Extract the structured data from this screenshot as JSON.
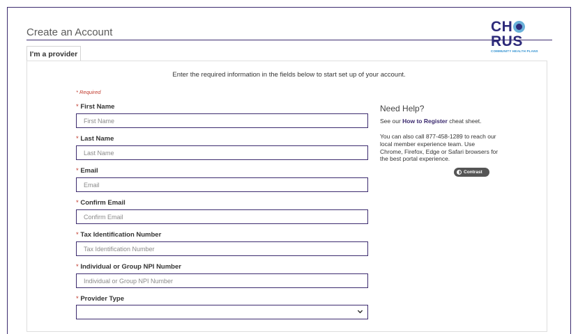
{
  "page_title": "Create an Account",
  "logo": {
    "main": "CHORUS",
    "sub": "COMMUNITY HEALTH PLANS"
  },
  "tab": {
    "label": "I'm a provider"
  },
  "intro": "Enter the required information in the fields below to start set up of your account.",
  "required_note": "* Required",
  "star": "* ",
  "fields": [
    {
      "label": "First Name",
      "placeholder": "First Name"
    },
    {
      "label": "Last Name",
      "placeholder": "Last Name"
    },
    {
      "label": "Email",
      "placeholder": "Email"
    },
    {
      "label": "Confirm Email",
      "placeholder": "Confirm Email"
    },
    {
      "label": "Tax Identification Number",
      "placeholder": "Tax Identification Number"
    },
    {
      "label": "Individual or Group NPI Number",
      "placeholder": "Individual or Group NPI Number"
    },
    {
      "label": "Provider Type",
      "value": ""
    }
  ],
  "help": {
    "title": "Need Help?",
    "line_prefix": "See our ",
    "link": "How to Register",
    "line_suffix": " cheat sheet.",
    "paragraph": "You can also call 877-458-1289 to reach our local member experience team. Use Chrome, Firefox, Edge or Safari browsers for the best portal experience.",
    "contrast_label": "Contrast"
  },
  "colors": {
    "accent": "#3b2a6e",
    "required": "#c0392b"
  }
}
